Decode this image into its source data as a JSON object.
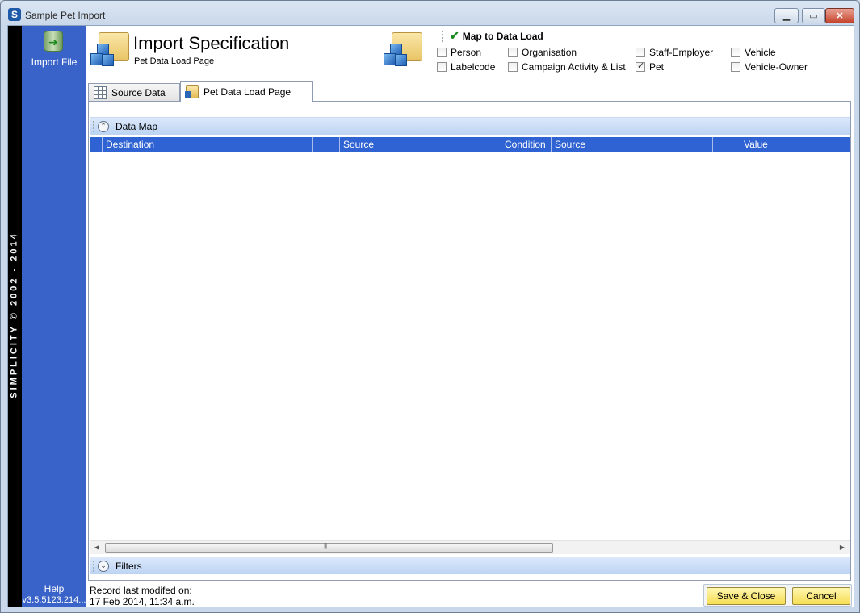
{
  "window": {
    "title": "Sample Pet Import",
    "app_icon_letter": "S"
  },
  "brand": {
    "text": "SIMPLICITY © 2002 - 2014"
  },
  "sidebar": {
    "import_file_label": "Import File",
    "help_label": "Help",
    "version": "v3.5.5123.214..."
  },
  "header": {
    "title": "Import Specification",
    "subtitle": "Pet Data Load Page",
    "map_to_data_load": "Map to Data Load"
  },
  "data_loads": [
    {
      "label": "Person",
      "checked": false
    },
    {
      "label": "Organisation",
      "checked": false
    },
    {
      "label": "Staff-Employer",
      "checked": false
    },
    {
      "label": "Vehicle",
      "checked": false
    },
    {
      "label": "Labelcode",
      "checked": false
    },
    {
      "label": "Campaign Activity & List",
      "checked": false
    },
    {
      "label": "Pet",
      "checked": true
    },
    {
      "label": "Vehicle-Owner",
      "checked": false
    }
  ],
  "tabs": [
    {
      "label": "Source Data",
      "active": false
    },
    {
      "label": "Pet Data Load Page",
      "active": true
    }
  ],
  "data_map": {
    "section_label": "Data Map",
    "columns": [
      "",
      "Destination",
      "",
      "Source",
      "Condition",
      "Source",
      "",
      "Value"
    ],
    "rows": []
  },
  "filters": {
    "section_label": "Filters"
  },
  "footer": {
    "record_label": "Record last modifed on:",
    "record_date": "17 Feb 2014, 11:34 a.m.",
    "save_close": "Save & Close",
    "cancel": "Cancel"
  }
}
